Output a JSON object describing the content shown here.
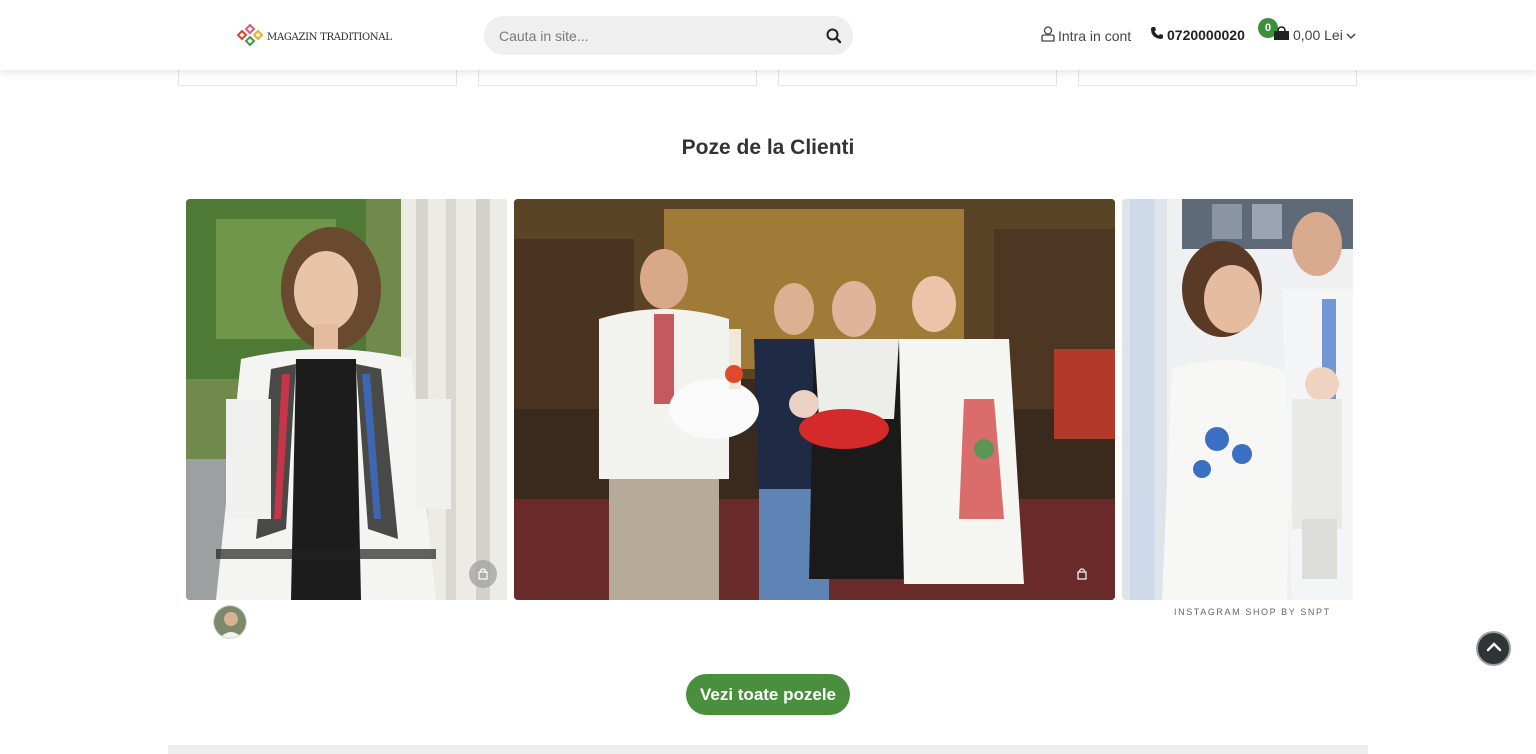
{
  "header": {
    "logo_text": "MAGAZIN TRADITIONAL",
    "search_placeholder": "Cauta in site...",
    "account_label": "Intra in cont",
    "phone": "0720000020",
    "cart_count": "0",
    "cart_total": "0,00 Lei"
  },
  "gallery": {
    "title": "Poze de la Clienti",
    "credit": "INSTAGRAM SHOP BY SNPT",
    "cta_label": "Vezi toate pozele"
  },
  "colors": {
    "brand_green": "#4a8f3d",
    "badge_green": "#3d8f3a",
    "search_bg": "#efefef"
  },
  "icons": [
    "search-icon",
    "user-icon",
    "phone-icon",
    "shopping-bag-icon",
    "chevron-down-icon",
    "chevron-up-icon"
  ]
}
